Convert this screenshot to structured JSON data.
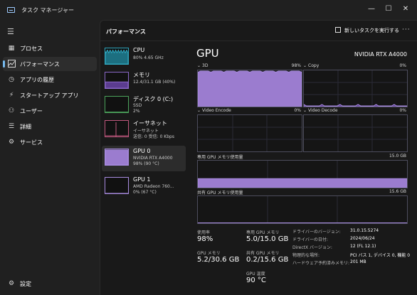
{
  "window": {
    "title": "タスク マネージャー",
    "minimize": "—",
    "maximize": "☐",
    "close": "✕"
  },
  "sidebar": {
    "items": [
      {
        "label": "プロセス",
        "icon": "grid-icon"
      },
      {
        "label": "パフォーマンス",
        "icon": "performance-icon"
      },
      {
        "label": "アプリの履歴",
        "icon": "history-icon"
      },
      {
        "label": "スタートアップ アプリ",
        "icon": "startup-icon"
      },
      {
        "label": "ユーザー",
        "icon": "users-icon"
      },
      {
        "label": "詳細",
        "icon": "details-icon"
      },
      {
        "label": "サービス",
        "icon": "services-icon"
      }
    ],
    "settings": "設定"
  },
  "header": {
    "title": "パフォーマンス",
    "run_task": "新しいタスクを実行する",
    "more": "···"
  },
  "devices": [
    {
      "name": "CPU",
      "sub1": "80%  4.65 GHz",
      "sub2": ""
    },
    {
      "name": "メモリ",
      "sub1": "12.4/31.1 GB (40%)",
      "sub2": ""
    },
    {
      "name": "ディスク 0 (C:)",
      "sub1": "SSD",
      "sub2": "2%"
    },
    {
      "name": "イーサネット",
      "sub1": "イーサネット",
      "sub2": "送信: 0 受信: 0 Kbps"
    },
    {
      "name": "GPU 0",
      "sub1": "NVIDIA RTX A4000",
      "sub2": "98% (90 °C)"
    },
    {
      "name": "GPU 1",
      "sub1": "AMD Radeon 760...",
      "sub2": "0% (67 °C)"
    }
  ],
  "gpu": {
    "title": "GPU",
    "model": "NVIDIA RTX A4000",
    "engines": [
      {
        "label": "3D",
        "value": "98%"
      },
      {
        "label": "Copy",
        "value": "0%"
      },
      {
        "label": "Video Encode",
        "value": "0%"
      },
      {
        "label": "Video Decode",
        "value": "0%"
      }
    ],
    "dedicated_mem": {
      "label": "専用 GPU メモリ使用量",
      "max": "15.0 GB"
    },
    "shared_mem": {
      "label": "共有 GPU メモリ使用量",
      "max": "15.6 GB"
    }
  },
  "stats": {
    "utilization": {
      "label": "使用率",
      "value": "98%"
    },
    "gpu_memory": {
      "label": "GPU メモリ",
      "value": "5.2/30.6 GB"
    },
    "dedicated": {
      "label": "専用 GPU メモリ",
      "value": "5.0/15.0 GB"
    },
    "shared": {
      "label": "共有 GPU メモリ",
      "value": "0.2/15.6 GB"
    },
    "temperature": {
      "label": "GPU 温度",
      "value": "90 °C"
    }
  },
  "details": [
    {
      "key": "ドライバーのバージョン:",
      "value": "31.0.15.5274"
    },
    {
      "key": "ドライバーの日付:",
      "value": "2024/06/24"
    },
    {
      "key": "DirectX バージョン:",
      "value": "12 (FL 12.1)"
    },
    {
      "key": "物理的な場所:",
      "value": "PCI バス 1, デバイス 0, 機能 0"
    },
    {
      "key": "ハードウェア予約済みメモリ:",
      "value": "201 MB"
    }
  ],
  "colors": {
    "gpu_fill": "#9b7ccf",
    "gpu_line": "#a88be0",
    "cpu_fill": "#1c6f80",
    "cpu_line": "#2fa6bd",
    "mem_fill": "#5b3c8f",
    "disk_line": "#4ba25b",
    "net_line": "#c0577d"
  },
  "graph_levels": {
    "engine_3d": 0.98,
    "copy": 0.02,
    "dedicated_mem": 0.333,
    "shared_mem": 0.013,
    "thumb_cpu": 0.8,
    "thumb_mem": 0.4,
    "thumb_disk": 0.02,
    "thumb_gpu0": 0.98,
    "thumb_gpu1": 0.0
  }
}
